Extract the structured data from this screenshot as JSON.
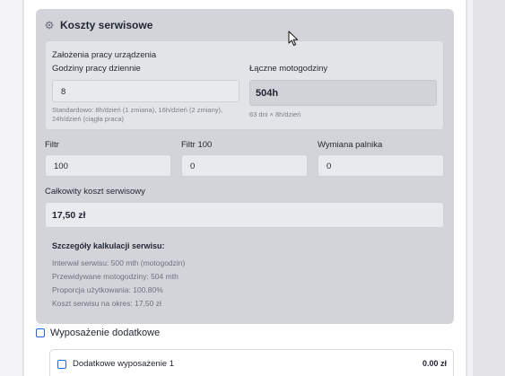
{
  "service": {
    "title": "Koszty serwisowe",
    "assumptions": {
      "title": "Założenia pracy urządzenia",
      "daily_hours_label": "Godziny pracy dziennie",
      "daily_hours_value": "8",
      "daily_hours_hint_1": "Standardowo: 8h/dzień (1 zmiana), 16h/dzień (2 zmiany),",
      "daily_hours_hint_2": "24h/dzień (ciągła praca)",
      "total_hours_label": "Łączne motogodziny",
      "total_hours_value": "504h",
      "total_hours_hint": "63 dni × 8h/dzień"
    },
    "filter_label": "Filtr",
    "filter_value": "100",
    "filter100_label": "Filtr 100",
    "filter100_value": "0",
    "burner_label": "Wymiana palnika",
    "burner_value": "0",
    "total_cost_label": "Całkowity koszt serwisowy",
    "total_cost_value": "17,50 zł",
    "details": {
      "title": "Szczegóły kalkulacji serwisu:",
      "lines": [
        "Interwał serwisu: 500 mth (motogodzin)",
        "Przewidywane motogodziny: 504 mth",
        "Proporcja użytkowania: 100.80%",
        "Koszt serwisu na okres: 17,50 zł"
      ]
    }
  },
  "addons": {
    "title": "Wyposażenie dodatkowe",
    "items": [
      {
        "label": "Dodatkowe wyposażenie 1",
        "price": "0.00 zł"
      }
    ]
  },
  "icons": {
    "section": "gear-icon",
    "pointer": "mouse-cursor-icon"
  },
  "colors": {
    "accent": "#2563eb",
    "panel": "#d3d4da",
    "subpanel": "#e3e4e8"
  }
}
